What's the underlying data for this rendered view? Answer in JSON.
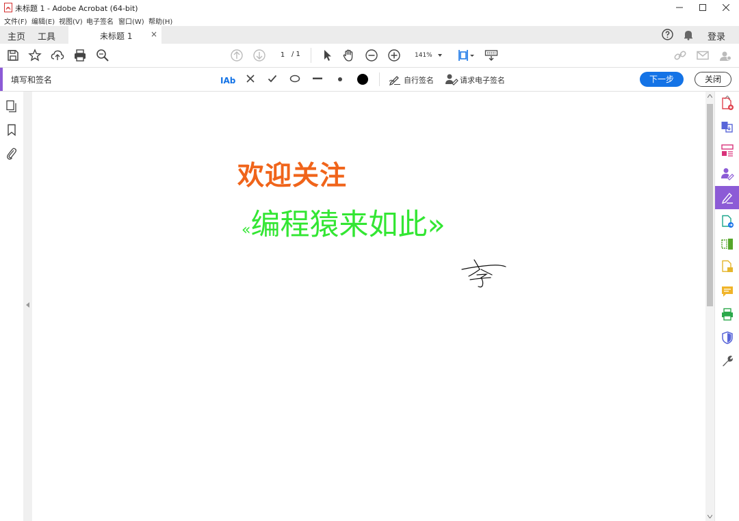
{
  "window": {
    "title": "未标题 1 - Adobe Acrobat (64-bit)"
  },
  "menu": [
    {
      "label": "文件(F)"
    },
    {
      "label": "编辑(E)"
    },
    {
      "label": "视图(V)"
    },
    {
      "label": "电子签名"
    },
    {
      "label": "窗口(W)"
    },
    {
      "label": "帮助(H)"
    }
  ],
  "tabs": {
    "home": "主页",
    "tools": "工具",
    "document": "未标题 1",
    "close_glyph": "×",
    "login": "登录"
  },
  "toolbar": {
    "page_current": "1",
    "page_total": "/ 1",
    "zoom": "141%"
  },
  "sign_bar": {
    "title": "填写和签名",
    "text_tool": "IAb",
    "self_sign": "自行签名",
    "request_esign": "请求电子签名",
    "next_button": "下一步",
    "close_button": "关闭"
  },
  "document": {
    "line1": "欢迎关注",
    "line2_open": "«",
    "line2": "编程猿来如此",
    "line2_close": "»"
  },
  "colors": {
    "accent_purple": "#8c5bd6",
    "button_blue": "#1473e6",
    "welcome_orange": "#f0641a",
    "channel_green": "#33e633"
  }
}
